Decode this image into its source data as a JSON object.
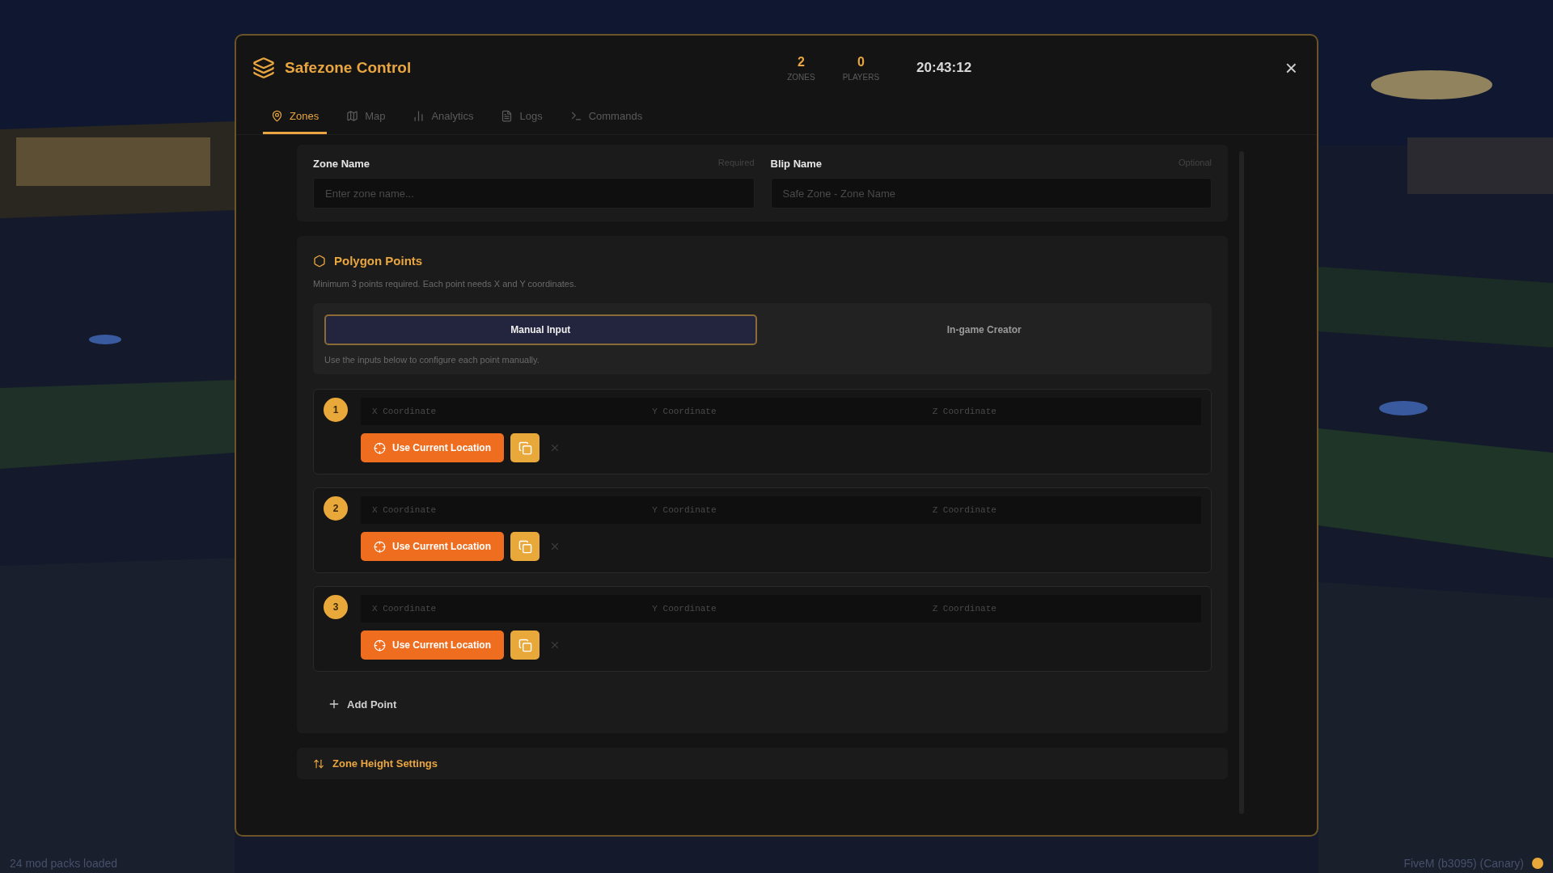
{
  "window": {
    "title": "Safezone Control",
    "close": "×"
  },
  "stats": [
    {
      "value": "2",
      "label": "ZONES"
    },
    {
      "value": "0",
      "label": "PLAYERS"
    }
  ],
  "clock": "20:43:12",
  "tabs": [
    {
      "label": "Zones",
      "selected": true
    },
    {
      "label": "Map",
      "selected": false
    },
    {
      "label": "Analytics",
      "selected": false
    },
    {
      "label": "Logs",
      "selected": false
    },
    {
      "label": "Commands",
      "selected": false
    }
  ],
  "fields": [
    {
      "label": "Zone Name",
      "hint": "Required",
      "placeholder": "Enter zone name..."
    },
    {
      "label": "Blip Name",
      "hint": "Optional",
      "placeholder": "Safe Zone - Zone Name"
    }
  ],
  "polygon": {
    "title": "Polygon Points",
    "description": "Minimum 3 points required. Each point needs X and Y coordinates.",
    "modes": [
      {
        "label": "Manual Input",
        "selected": true
      },
      {
        "label": "In-game Creator",
        "selected": false
      }
    ],
    "mode_hint": "Use the inputs below to configure each point manually.",
    "points": [
      {
        "number": "1",
        "placeholders": [
          "X Coordinate",
          "Y Coordinate",
          "Z Coordinate"
        ],
        "button": "Use Current Location"
      },
      {
        "number": "2",
        "placeholders": [
          "X Coordinate",
          "Y Coordinate",
          "Z Coordinate"
        ],
        "button": "Use Current Location"
      },
      {
        "number": "3",
        "placeholders": [
          "X Coordinate",
          "Y Coordinate",
          "Z Coordinate"
        ],
        "button": "Use Current Location"
      }
    ],
    "add_button": "Add Point"
  },
  "next_section": {
    "title": "Zone Height Settings"
  },
  "status_left": "24 mod packs loaded",
  "status_right": "FiveM (b3095) (Canary)"
}
